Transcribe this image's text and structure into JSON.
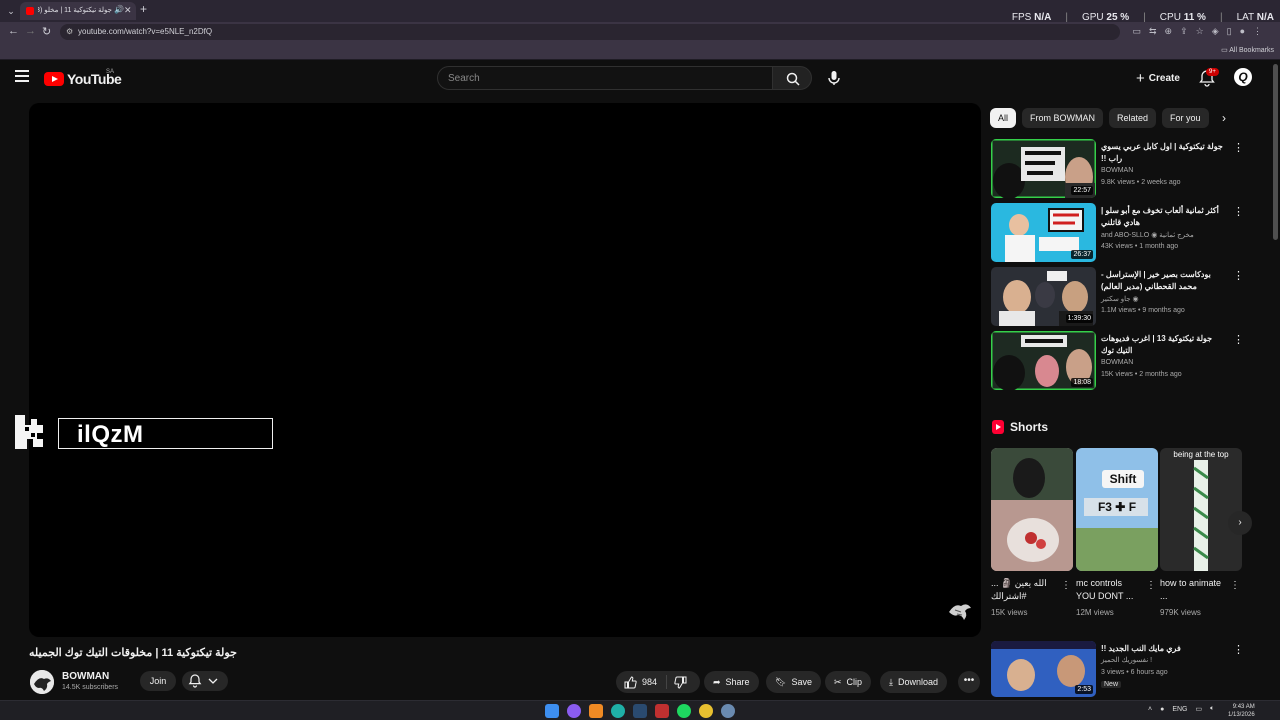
{
  "browser": {
    "tab_title": "جولة تيكتوكية 11 | مخلو (123)",
    "url": "youtube.com/watch?v=e5NLE_n2DfQ",
    "bookmarks_label": "All Bookmarks",
    "perf": [
      {
        "label": "FPS",
        "value": "N/A"
      },
      {
        "label": "GPU",
        "value": "25 %"
      },
      {
        "label": "CPU",
        "value": "11 %"
      },
      {
        "label": "LAT",
        "value": "N/A"
      }
    ]
  },
  "header": {
    "logo_text": "YouTube",
    "region": "SA",
    "search_placeholder": "Search",
    "create_label": "Create",
    "notif_badge": "9+",
    "avatar_letter": "Q"
  },
  "video": {
    "overlay_text": "ilQzM",
    "title": "جولة تيكتوكية 11 | مخلوقات التيك توك الجميله",
    "channel": "BOWMAN",
    "subscribers": "14.5K subscribers",
    "join_label": "Join",
    "likes": "984",
    "share_label": "Share",
    "save_label": "Save",
    "clip_label": "Clip",
    "download_label": "Download"
  },
  "chips": [
    "All",
    "From BOWMAN",
    "Related",
    "For you"
  ],
  "recommendations": [
    {
      "title": "جولة تيكتوكية | اول كابل عربي يسوي راب !!",
      "channel": "BOWMAN",
      "meta": "9.8K views • 2 weeks ago",
      "duration": "22:57"
    },
    {
      "title": "أكثر ثمانية ألعاب تخوف مع أبو سلو | هادي قاتلني",
      "channel": "and ABO-SLLO ◉ مخرج ثمانية",
      "meta": "43K views • 1 month ago",
      "duration": "26:37"
    },
    {
      "title": "بودكاست بصير خير | الإستراسل - محمد القحطاني (مدير العالم)",
      "channel": "جاو سكتير ◉",
      "meta": "1.1M views • 9 months ago",
      "duration": "1:39:30"
    },
    {
      "title": "جولة تيكتوكية 13 | اغرب فديوهات التيك توك",
      "channel": "BOWMAN",
      "meta": "15K views • 2 months ago",
      "duration": "18:08"
    }
  ],
  "shorts": {
    "heading": "Shorts",
    "items": [
      {
        "title": "الله يعين 🗿 ... #اشترالك",
        "views": "15K views"
      },
      {
        "title": "mc controls YOU DONT ...",
        "views": "12M views",
        "thumb_text": "Shift",
        "thumb_keys": "F3 ✚ F"
      },
      {
        "title": "how to animate ...",
        "views": "979K views",
        "thumb_text": "being at the top"
      }
    ]
  },
  "next_rec": {
    "title": "فري مايك النب الجديد !!",
    "channel": "نفسوريك الحميز !",
    "meta": "3 views • 6 hours ago",
    "badge": "New",
    "duration": "2:53"
  },
  "taskbar": {
    "lang": "ENG",
    "time": "9:43 AM",
    "date": "1/13/2026"
  },
  "colors": {
    "background": "#0f0f0f",
    "brand_red": "#ff0000",
    "chip_bg": "#272727",
    "text_secondary": "#aaaaaa"
  }
}
